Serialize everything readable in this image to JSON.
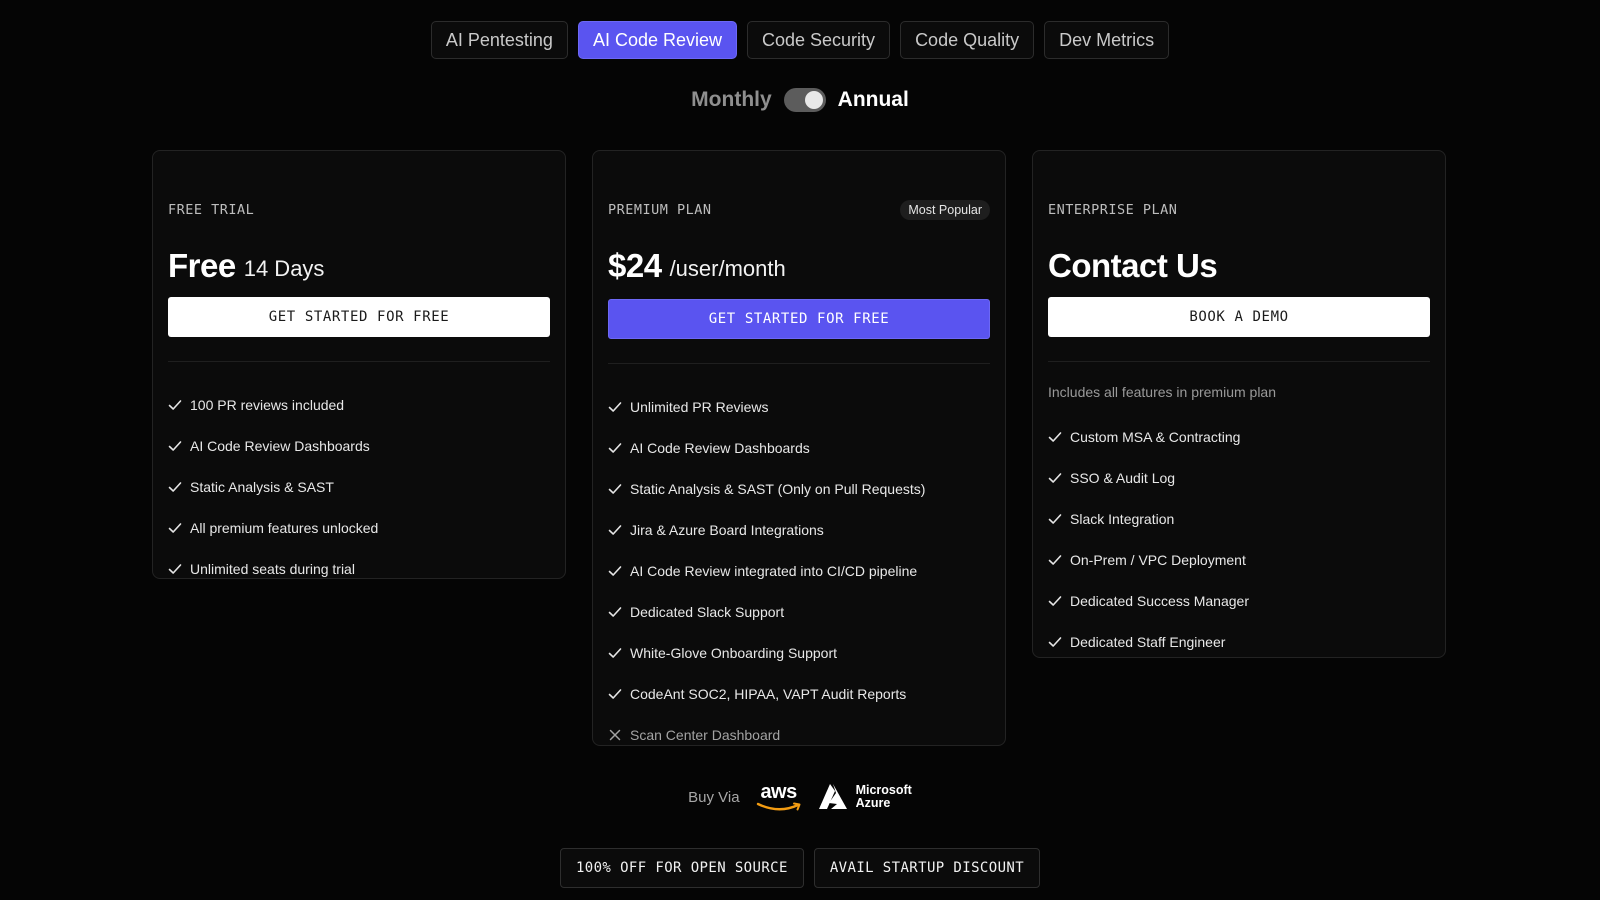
{
  "tabs": [
    {
      "label": "AI Pentesting",
      "active": false
    },
    {
      "label": "AI Code Review",
      "active": true
    },
    {
      "label": "Code Security",
      "active": false
    },
    {
      "label": "Code Quality",
      "active": false
    },
    {
      "label": "Dev Metrics",
      "active": false
    }
  ],
  "billing": {
    "monthly_label": "Monthly",
    "annual_label": "Annual",
    "selected": "Annual"
  },
  "plans": {
    "free": {
      "name": "FREE TRIAL",
      "price": "Free",
      "price_suffix": "14 Days",
      "cta": "GET STARTED FOR FREE",
      "features": [
        "100 PR reviews included",
        "AI Code Review Dashboards",
        "Static Analysis & SAST",
        "All premium features unlocked",
        "Unlimited seats during trial"
      ]
    },
    "premium": {
      "name": "PREMIUM PLAN",
      "badge": "Most Popular",
      "price": "$24",
      "price_suffix": "/user/month",
      "cta": "GET STARTED FOR FREE",
      "features": [
        "Unlimited PR Reviews",
        "AI Code Review Dashboards",
        "Static Analysis & SAST (Only on Pull Requests)",
        "Jira & Azure Board Integrations",
        "AI Code Review integrated into CI/CD pipeline",
        "Dedicated Slack Support",
        "White-Glove Onboarding Support",
        "CodeAnt SOC2, HIPAA, VAPT Audit Reports"
      ],
      "excluded_features": [
        "Scan Center Dashboard"
      ]
    },
    "enterprise": {
      "name": "ENTERPRISE PLAN",
      "price": "Contact Us",
      "cta": "BOOK A DEMO",
      "includes": "Includes all features in premium plan",
      "features": [
        "Custom MSA & Contracting",
        "SSO & Audit Log",
        "Slack Integration",
        "On-Prem / VPC Deployment",
        "Dedicated Success Manager",
        "Dedicated Staff Engineer"
      ]
    }
  },
  "buy_via": {
    "label": "Buy Via",
    "aws": "aws",
    "azure_line1": "Microsoft",
    "azure_line2": "Azure"
  },
  "discounts": {
    "open_source": "100% OFF FOR OPEN SOURCE",
    "startup": "AVAIL STARTUP DISCOUNT"
  },
  "colors": {
    "accent": "#5a54f0",
    "background": "#050505",
    "card": "#0b0b0b"
  },
  "icons": {
    "included": "check-icon",
    "excluded": "x-icon"
  }
}
